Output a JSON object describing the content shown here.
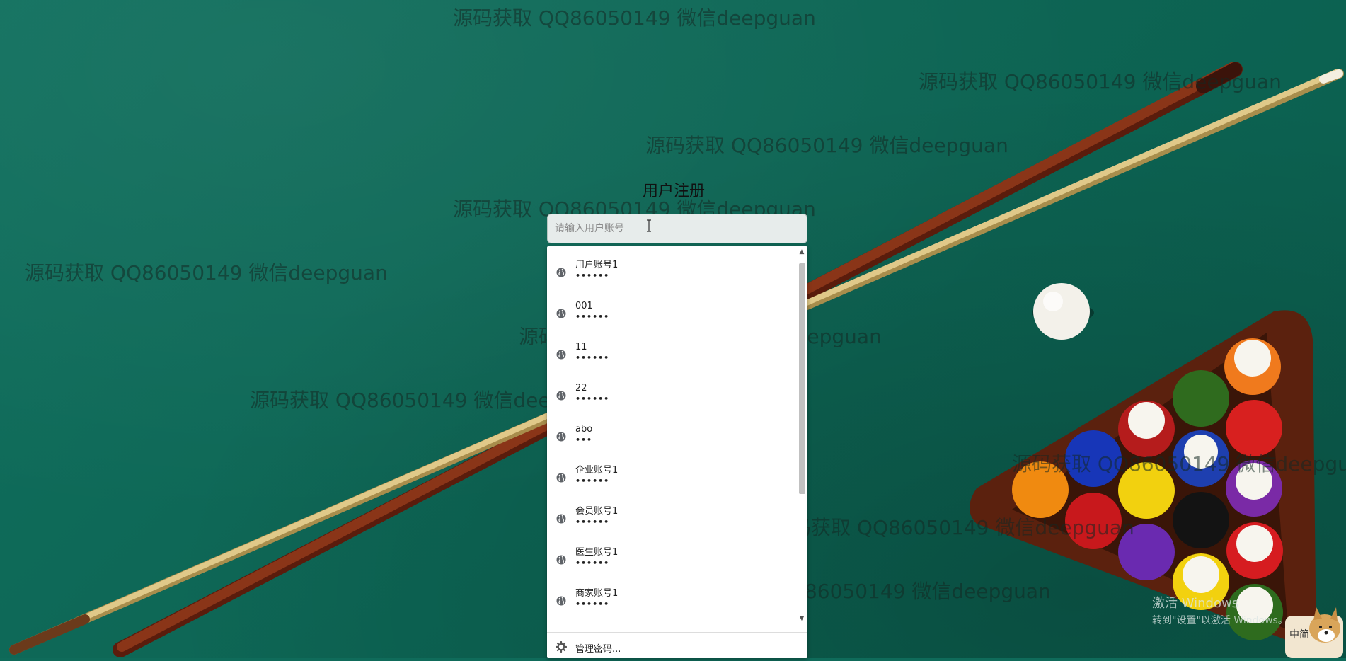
{
  "form": {
    "title": "用户注册",
    "account_placeholder": "请输入用户账号"
  },
  "autofill": {
    "items": [
      {
        "user": "用户账号1",
        "password": "••••••"
      },
      {
        "user": "001",
        "password": "••••••"
      },
      {
        "user": "11",
        "password": "••••••"
      },
      {
        "user": "22",
        "password": "••••••"
      },
      {
        "user": "abo",
        "password": "•••"
      },
      {
        "user": "企业账号1",
        "password": "••••••"
      },
      {
        "user": "会员账号1",
        "password": "••••••"
      },
      {
        "user": "医生账号1",
        "password": "••••••"
      },
      {
        "user": "商家账号1",
        "password": "••••••"
      }
    ],
    "manage_label": "管理密码...",
    "item_icon": "globe-icon",
    "manage_icon": "gear-icon"
  },
  "watermark": {
    "text": "源码获取 QQ86050149 微信deepguan"
  },
  "windows_activation": {
    "line1": "激活 Windows",
    "line2": "转到\"设置\"以激活 Windows。"
  },
  "ime": {
    "label": "中简"
  },
  "colors": {
    "felt": "#0f6b5a",
    "cue_wood": "#7a2a14",
    "cue_light": "#d8c078",
    "rack": "#6b2a12"
  }
}
